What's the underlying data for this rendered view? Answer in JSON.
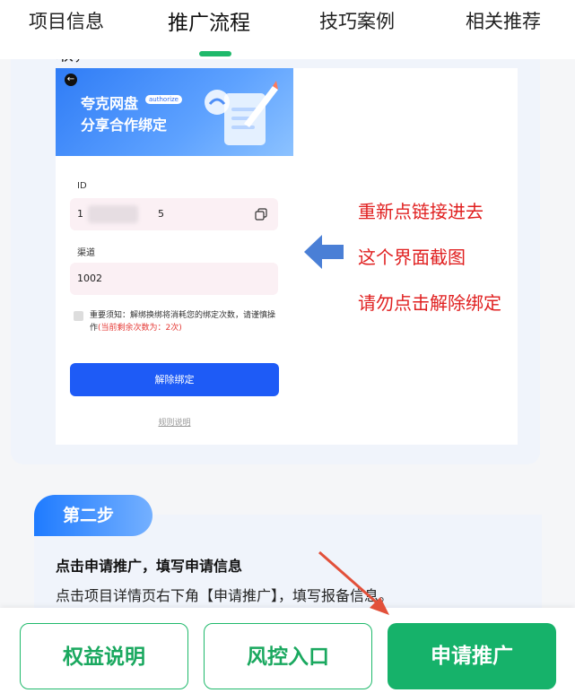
{
  "tabs": [
    {
      "label": "项目信息",
      "active": false
    },
    {
      "label": "推广流程",
      "active": true
    },
    {
      "label": "技巧案例",
      "active": false
    },
    {
      "label": "相关推荐",
      "active": false
    }
  ],
  "accent_color": "#1fb96b",
  "cut_off_text": "取，",
  "screenshot": {
    "banner_title": "夸克网盘",
    "banner_badge": "authorize",
    "banner_subtitle": "分享合作绑定",
    "id_label": "ID",
    "id_value_start": "1",
    "id_value_end": "5",
    "channel_label": "渠道",
    "channel_value": "1002",
    "notice_text": "重要须知：解绑换绑将消耗您的绑定次数，请谨慎操作",
    "notice_remaining": "(当前剩余次数为：2次)",
    "unbind_button": "解除绑定",
    "rules_link": "规则说明"
  },
  "annotations": [
    "重新点链接进去",
    "这个界面截图",
    "请勿点击解除绑定"
  ],
  "step2": {
    "badge": "第二步",
    "title": "点击申请推广，填写申请信息",
    "desc": "点击项目详情页右下角【申请推广】，填写报备信息。"
  },
  "bottom_buttons": {
    "rights": "权益说明",
    "risk": "风控入口",
    "apply": "申请推广"
  }
}
